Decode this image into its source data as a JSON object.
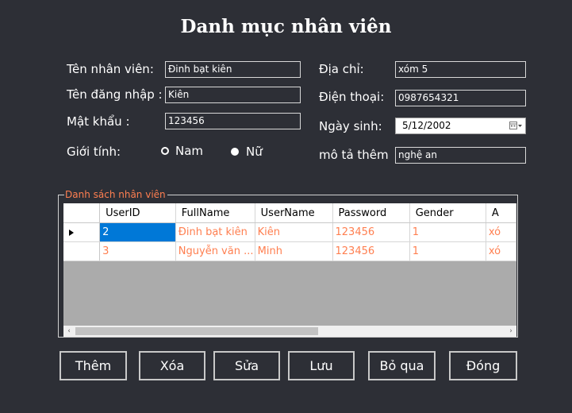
{
  "title": "Danh mục nhân viên",
  "form": {
    "ten_nhan_vien": {
      "label": "Tên nhân viên:",
      "value": "Đinh bạt kiên"
    },
    "ten_dang_nhap": {
      "label": "Tên đăng nhập :",
      "value": "Kiên"
    },
    "mat_khau": {
      "label": "Mật khẩu :",
      "value": "123456"
    },
    "gioi_tinh": {
      "label": "Giới tính:",
      "options": [
        "Nam",
        "Nữ"
      ],
      "selected": "Nữ"
    },
    "dia_chi": {
      "label": "Địa chỉ:",
      "value": "xóm 5"
    },
    "dien_thoai": {
      "label": "Điện thoại:",
      "value": "0987654321"
    },
    "ngay_sinh": {
      "label": "Ngày sinh:",
      "value": "5/12/2002"
    },
    "mo_ta_them": {
      "label": "mô tả thêm",
      "value": "nghệ an"
    }
  },
  "list": {
    "legend": "Danh sách nhân viên",
    "columns": [
      "UserID",
      "FullName",
      "UserName",
      "Password",
      "Gender",
      "A"
    ],
    "rows": [
      [
        "2",
        "Đinh bạt kiên",
        "Kiên",
        "123456",
        "1",
        "xó"
      ],
      [
        "3",
        "Nguyễn văn ...",
        "Minh",
        "123456",
        "1",
        "xó"
      ]
    ]
  },
  "buttons": {
    "them": "Thêm",
    "xoa": "Xóa",
    "sua": "Sửa",
    "luu": "Lưu",
    "bo_qua": "Bỏ qua",
    "dong": "Đóng"
  },
  "colors": {
    "background": "#2d2f36",
    "grid_text": "#ff7f50",
    "selection": "#0078d7"
  }
}
